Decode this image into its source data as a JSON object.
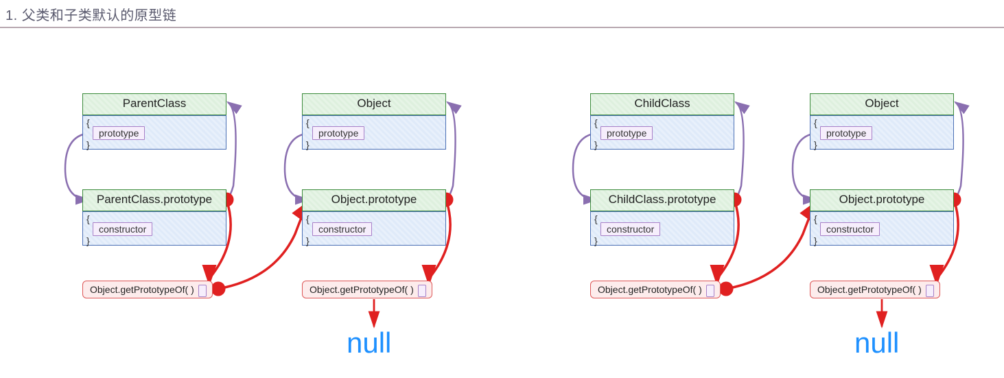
{
  "heading": "1. 父类和子类默认的原型链",
  "labels": {
    "prototype": "prototype",
    "constructor": "constructor",
    "getProto": "Object.getPrototypeOf(   )",
    "null": "null"
  },
  "columns": [
    {
      "title": "ParentClass",
      "protoTitle": "ParentClass.prototype"
    },
    {
      "title": "Object",
      "protoTitle": "Object.prototype"
    },
    {
      "title": "ChildClass",
      "protoTitle": "ChildClass.prototype"
    },
    {
      "title": "Object",
      "protoTitle": "Object.prototype"
    }
  ],
  "diagram_semantics": {
    "description": "Default prototype chains for a parent class and a child class (no inheritance link drawn between them).",
    "chains": [
      [
        "ParentClass.prototype",
        "Object.prototype",
        "null"
      ],
      [
        "ChildClass.prototype",
        "Object.prototype",
        "null"
      ]
    ],
    "purple_arrows": "prototype property of each class points to its .prototype object; constructor property of each .prototype object points back to the class.",
    "red_arrows": "Object.getPrototypeOf(X.prototype) → Object.prototype, and Object.getPrototypeOf(Object.prototype) → null."
  }
}
